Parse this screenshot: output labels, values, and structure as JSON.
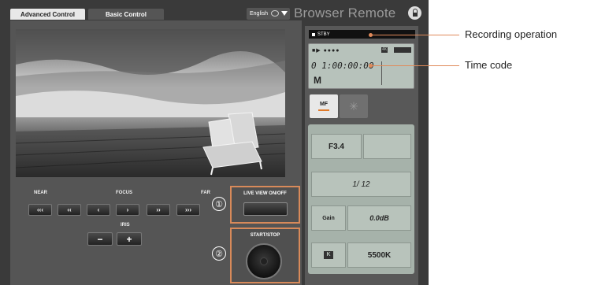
{
  "tabs": {
    "advanced": "Advanced Control",
    "basic": "Basic Control"
  },
  "language": {
    "selected": "English",
    "icons": [
      "chat-icon",
      "dropdown-arrow-icon"
    ]
  },
  "brand": "Browser Remote",
  "controls": {
    "near": "NEAR",
    "focus": "FOCUS",
    "far": "FAR",
    "iris": "IRIS",
    "focus_buttons": [
      "‹‹‹",
      "‹‹",
      "‹",
      "›",
      "››",
      "›››"
    ],
    "iris_buttons": [
      "−",
      "+"
    ],
    "live_view_label": "LIVE VIEW ON/OFF",
    "start_stop_label": "START/STOP"
  },
  "markers": {
    "one": "①",
    "two": "②"
  },
  "status": {
    "stby": "STBY",
    "indicators": "●●●●",
    "badge_4k": "4K",
    "timecode": "0 1:00:00:00",
    "mode": "M"
  },
  "focus_mode": {
    "mf": "MF",
    "star": "✳"
  },
  "settings": {
    "iris": "F3.4",
    "shutter": "1/ 12",
    "gain_label": "Gain",
    "gain_value": "0.0dB",
    "wb_badge": "K",
    "white_balance": "5500K"
  },
  "annotations": {
    "recording": "Recording operation",
    "timecode": "Time code"
  },
  "colors": {
    "accent": "#e08a5a",
    "highlight": "#d88a5a",
    "lcd": "#b7c2bb"
  }
}
